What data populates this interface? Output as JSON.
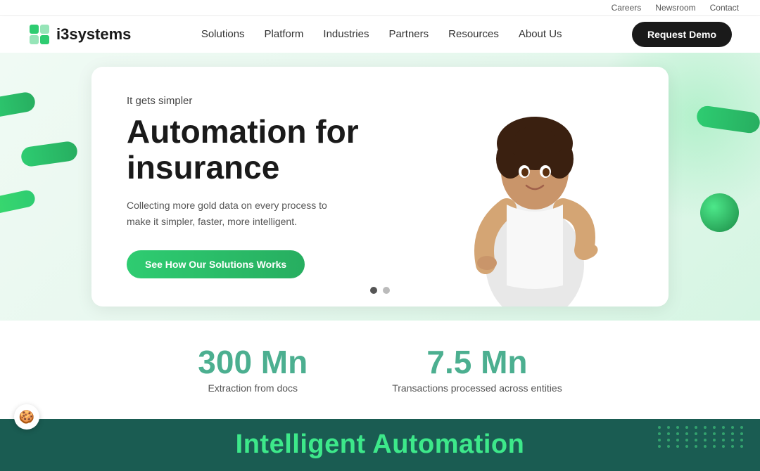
{
  "utility_bar": {
    "links": [
      {
        "label": "Careers",
        "href": "#"
      },
      {
        "label": "Newsroom",
        "href": "#"
      },
      {
        "label": "Contact",
        "href": "#"
      }
    ]
  },
  "nav": {
    "logo_text": "i3systems",
    "links": [
      {
        "label": "Solutions",
        "href": "#"
      },
      {
        "label": "Platform",
        "href": "#"
      },
      {
        "label": "Industries",
        "href": "#"
      },
      {
        "label": "Partners",
        "href": "#"
      },
      {
        "label": "Resources",
        "href": "#"
      },
      {
        "label": "About Us",
        "href": "#"
      }
    ],
    "cta_label": "Request Demo"
  },
  "hero": {
    "subtitle": "It gets simpler",
    "title": "Automation for insurance",
    "description": "Collecting more gold data on every process to make it simpler, faster, more intelligent.",
    "cta_label": "See How Our Solutions Works"
  },
  "stats": [
    {
      "number": "300 Mn",
      "label": "Extraction from docs"
    },
    {
      "number": "7.5 Mn",
      "label": "Transactions processed across entities"
    }
  ],
  "bottom_section": {
    "title": "Intelligent Automation"
  },
  "colors": {
    "green_primary": "#2ecc71",
    "green_dark": "#27ae60",
    "teal_bg": "#1a5c52",
    "stat_color": "#4CAF90"
  }
}
